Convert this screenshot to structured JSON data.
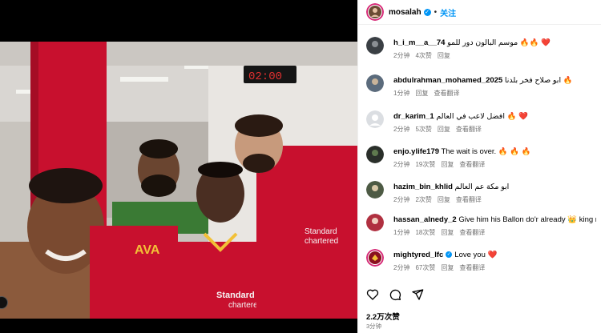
{
  "post": {
    "username": "mosalah",
    "dot": "•",
    "follow_label": "关注",
    "likes": "2.2万次赞",
    "time_ago": "3分钟"
  },
  "comments": [
    {
      "user": "h_i_m__a__74",
      "text": "موسم البالون دور للمو 🔥🔥 ❤️",
      "time": "2分钟",
      "likes": "4次赞",
      "reply": "回复",
      "translate": "",
      "avatar": "#3a3f44"
    },
    {
      "user": "abdulrahman_mohamed_2025",
      "text": "ابو صلاح فخر بلدنا 🔥",
      "time": "1分钟",
      "likes": "",
      "reply": "回复",
      "translate": "查看翻译",
      "avatar": "#5b6b7c"
    },
    {
      "user": "dr_karim_1",
      "text": "افضل لاعب في العالم 🔥 ❤️",
      "time": "2分钟",
      "likes": "5次赞",
      "reply": "回复",
      "translate": "查看翻译",
      "avatar": "#c7cbd1"
    },
    {
      "user": "enjo.ylife179",
      "text": "The wait is over. 🔥 🔥 🔥",
      "time": "2分钟",
      "likes": "19次赞",
      "reply": "回复",
      "translate": "查看翻译",
      "avatar": "#2a2f2a"
    },
    {
      "user": "hazim_bin_khlid",
      "text": "ابو مكة عم العالم",
      "time": "2分钟",
      "likes": "2次赞",
      "reply": "回复",
      "translate": "查看翻译",
      "avatar": "#4d5a44"
    },
    {
      "user": "hassan_alnedy_2",
      "text": "Give him his Ballon do'r already 👑 king moh",
      "time": "1分钟",
      "likes": "18次赞",
      "reply": "回复",
      "translate": "查看翻译",
      "avatar": "#b03040"
    },
    {
      "user": "mightyred_lfc",
      "text": "Love you ❤️",
      "time": "2分钟",
      "likes": "67次赞",
      "reply": "回复",
      "translate": "查看翻译",
      "avatar": "#8a1020"
    }
  ],
  "icons": {
    "like": "heart-icon",
    "comment": "comment-icon",
    "share": "share-icon",
    "verified": "verified-badge-icon"
  }
}
